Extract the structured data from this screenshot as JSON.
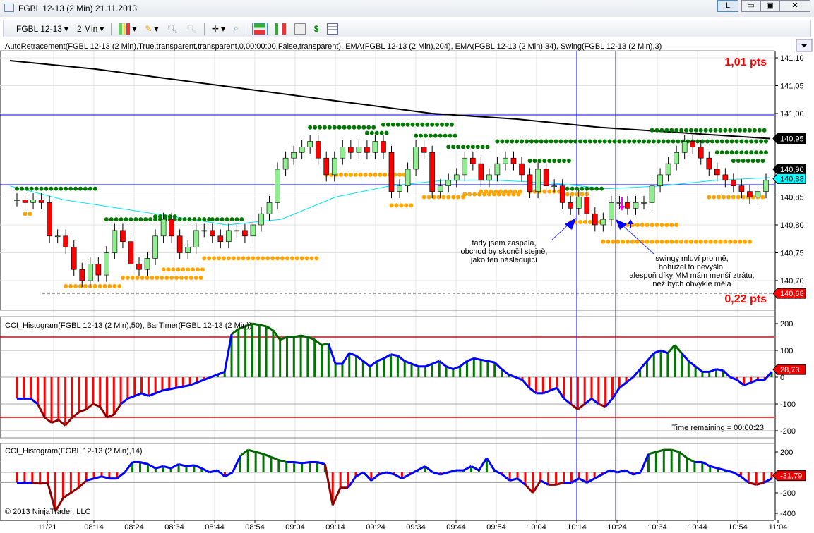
{
  "window": {
    "title": "FGBL 12-13 (2 Min)  21.11.2013",
    "btn_l": "L",
    "btn_min": "▭",
    "btn_max": "▣",
    "btn_close": "✕"
  },
  "toolbar": {
    "instrument": "FGBL 12-13",
    "interval": "2 Min",
    "icons": [
      "candlestick-style-icon",
      "pencil-draw-icon",
      "zoom-in-icon",
      "zoom-out-icon",
      "crosshair-icon",
      "magnifier-icon",
      "chart-trader-icon",
      "data-box-icon",
      "strategy-icon",
      "dollar-orders-icon",
      "properties-icon"
    ]
  },
  "price_panel": {
    "indicator_label": "AutoRetracement(FGBL 12-13 (2 Min),True,transparent,transparent,0,00:00:00,False,transparent), EMA(FGBL 12-13 (2 Min),204), EMA(FGBL 12-13 (2 Min),34), Swing(FGBL 12-13 (2 Min),3)",
    "top_pts": "1,01 pts",
    "bottom_pts": "0,22 pts",
    "axis_labels": [
      "141,10",
      "141,05",
      "141,00",
      "140,85",
      "140,80",
      "140,75",
      "140,70"
    ],
    "axis_values": [
      141.1,
      141.05,
      141.0,
      140.85,
      140.8,
      140.75,
      140.7
    ],
    "badges": [
      {
        "text": "140,95",
        "value": 140.955,
        "color": "#000000",
        "fg": "#ffffff"
      },
      {
        "text": "140,90",
        "value": 140.9,
        "color": "#000000",
        "fg": "#ffffff"
      },
      {
        "text": "140,88",
        "value": 140.883,
        "color": "#00ffff",
        "fg": "#000000"
      },
      {
        "text": "140,68",
        "value": 140.677,
        "color": "#ff0000",
        "fg": "#ffffff"
      }
    ],
    "closes": [
      140.845,
      140.84,
      140.845,
      140.84,
      140.78,
      140.78,
      140.76,
      140.72,
      140.7,
      140.73,
      140.71,
      140.75,
      140.79,
      140.77,
      140.73,
      140.72,
      140.74,
      140.78,
      140.81,
      140.78,
      140.75,
      140.76,
      140.79,
      140.79,
      140.78,
      140.77,
      140.79,
      140.79,
      140.78,
      140.8,
      140.82,
      140.84,
      140.9,
      140.92,
      140.93,
      140.94,
      140.95,
      140.92,
      140.89,
      140.92,
      140.94,
      140.93,
      140.94,
      140.93,
      140.95,
      140.93,
      140.86,
      140.87,
      140.9,
      140.94,
      140.93,
      140.86,
      140.87,
      140.88,
      140.89,
      140.92,
      140.91,
      140.88,
      140.89,
      140.91,
      140.92,
      140.91,
      140.89,
      140.86,
      140.9,
      140.87,
      140.87,
      140.84,
      140.83,
      140.85,
      140.82,
      140.8,
      140.81,
      140.84,
      140.84,
      140.83,
      140.84,
      140.84,
      140.87,
      140.89,
      140.91,
      140.93,
      140.95,
      140.94,
      140.92,
      140.9,
      140.89,
      140.88,
      140.87,
      140.86,
      140.85,
      140.86,
      140.88
    ],
    "ema204": [
      141.095,
      141.08,
      141.06,
      141.04,
      141.02,
      141.0,
      140.99,
      140.975,
      140.965,
      140.955
    ],
    "ema34": [
      140.87,
      140.845,
      140.83,
      140.815,
      140.8,
      140.81,
      140.85,
      140.87,
      140.88,
      140.88,
      140.875,
      140.865,
      140.87,
      140.88,
      140.885
    ],
    "swing_highs": [
      [
        0,
        10,
        140.865
      ],
      [
        11,
        24,
        140.81
      ],
      [
        17,
        20,
        140.815
      ],
      [
        24,
        28,
        140.81
      ],
      [
        36,
        44,
        140.975
      ],
      [
        43,
        46,
        140.965
      ],
      [
        45,
        54,
        140.98
      ],
      [
        49,
        54,
        140.96
      ],
      [
        53,
        58,
        140.94
      ],
      [
        59,
        65,
        140.95
      ],
      [
        62,
        92,
        140.95
      ],
      [
        63,
        68,
        140.915
      ],
      [
        67,
        72,
        140.865
      ],
      [
        78,
        92,
        140.97
      ],
      [
        86,
        92,
        140.93
      ],
      [
        88,
        92,
        140.915
      ]
    ],
    "swing_lows": [
      [
        1,
        2,
        140.82
      ],
      [
        6,
        13,
        140.69
      ],
      [
        13,
        23,
        140.705
      ],
      [
        18,
        23,
        140.72
      ],
      [
        23,
        37,
        140.74
      ],
      [
        38,
        48,
        140.89
      ],
      [
        46,
        49,
        140.835
      ],
      [
        50,
        55,
        140.85
      ],
      [
        55,
        62,
        140.855
      ],
      [
        57,
        62,
        140.86
      ],
      [
        63,
        67,
        140.86
      ],
      [
        67,
        70,
        140.855
      ],
      [
        68,
        72,
        140.805
      ],
      [
        72,
        90,
        140.77
      ],
      [
        75,
        81,
        140.8
      ],
      [
        85,
        92,
        140.85
      ]
    ],
    "annotation_1": [
      "tady jsem zaspala,",
      "obchod by skončil stejně,",
      "jako ten následující"
    ],
    "annotation_2": [
      "swingy mluví pro mě,",
      "bohužel to nevyšlo,",
      "alespoň díky MM mám menší ztrátu,",
      "než bych obvykle měla"
    ]
  },
  "cci1_panel": {
    "label": "CCI_Histogram(FGBL 12-13 (2 Min),50), BarTimer(FGBL 12-13 (2 Min))",
    "time_remaining": "Time remaining = 00:00:23",
    "axis_labels": [
      "200",
      "100",
      "0",
      "-100",
      "-200"
    ],
    "axis_values": [
      200,
      100,
      0,
      -100,
      -200
    ],
    "badge": "28,73",
    "badge_value": 28.73,
    "values": [
      -80,
      -80,
      -80,
      -100,
      -150,
      -170,
      -160,
      -180,
      -150,
      -130,
      -120,
      -100,
      -110,
      -150,
      -140,
      -100,
      -80,
      -70,
      -60,
      -70,
      -60,
      -50,
      -45,
      -40,
      -35,
      -30,
      -20,
      -10,
      0,
      10,
      20,
      160,
      180,
      190,
      200,
      195,
      190,
      175,
      140,
      150,
      150,
      155,
      150,
      140,
      120,
      125,
      50,
      50,
      90,
      80,
      60,
      40,
      60,
      70,
      85,
      80,
      60,
      50,
      40,
      40,
      50,
      60,
      40,
      30,
      40,
      60,
      70,
      65,
      60,
      55,
      30,
      10,
      0,
      -10,
      -40,
      -60,
      -60,
      -50,
      -40,
      -80,
      -100,
      -120,
      -100,
      -80,
      -100,
      -110,
      -80,
      -40,
      -20,
      0,
      30,
      60,
      90,
      100,
      90,
      120,
      90,
      60,
      40,
      20,
      20,
      30,
      25,
      0,
      -10,
      -30,
      -20,
      -10,
      -10,
      20
    ]
  },
  "cci2_panel": {
    "label": "CCI_Histogram(FGBL 12-13 (2 Min),14)",
    "copyright": "© 2013 NinjaTrader, LLC",
    "axis_labels": [
      "200",
      "-200",
      "-400"
    ],
    "axis_values": [
      200,
      -200,
      -400
    ],
    "badge": "-31,79",
    "badge_value": -31.79,
    "values": [
      -100,
      -100,
      -100,
      -110,
      -100,
      -380,
      -250,
      -200,
      -150,
      -80,
      -60,
      -40,
      -60,
      -60,
      0,
      100,
      100,
      80,
      40,
      60,
      40,
      80,
      60,
      70,
      40,
      0,
      20,
      -40,
      0,
      160,
      220,
      200,
      180,
      150,
      120,
      100,
      100,
      90,
      100,
      100,
      80,
      -320,
      -150,
      -150,
      -40,
      0,
      -80,
      -20,
      0,
      -20,
      -60,
      -20,
      20,
      60,
      0,
      -20,
      0,
      20,
      20,
      60,
      20,
      140,
      20,
      -20,
      -80,
      -60,
      -120,
      -200,
      -80,
      -120,
      -120,
      -100,
      -100,
      -60,
      -100,
      -60,
      -20,
      20,
      0,
      20,
      -20,
      0,
      180,
      200,
      220,
      220,
      200,
      140,
      100,
      100,
      60,
      40,
      20,
      0,
      -40,
      -100,
      -120,
      -100,
      -60
    ]
  },
  "time_axis": {
    "labels": [
      "11/21",
      "08:14",
      "08:24",
      "08:34",
      "08:44",
      "08:54",
      "09:04",
      "09:14",
      "09:24",
      "09:34",
      "09:44",
      "09:54",
      "10:04",
      "10:14",
      "10:24",
      "10:34",
      "10:44",
      "10:54",
      "11:04"
    ]
  },
  "colors": {
    "up": "#90ee90",
    "down": "#ff0000",
    "swing_high": "#007700",
    "swing_low": "#ffa500",
    "ema204": "#000000",
    "ema34": "#00e5ee",
    "cci_pos": "#007700",
    "cci_neg": "#ff0000",
    "cci_line": "#0000ff",
    "pts": "#ff0000"
  }
}
